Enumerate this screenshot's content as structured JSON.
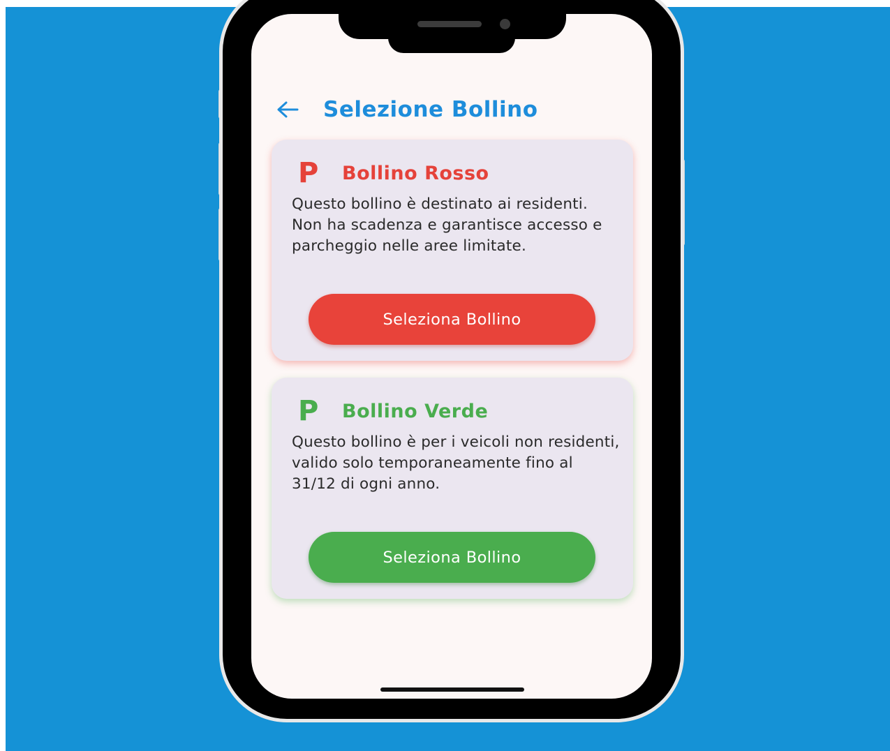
{
  "header": {
    "title": "Selezione Bollino",
    "back_icon": "arrow-left-icon"
  },
  "cards": [
    {
      "icon_letter": "P",
      "title": "Bollino Rosso",
      "description": "Questo bollino è destinato ai residenti. Non ha scadenza e garantisce accesso e parcheggio nelle aree limitate.",
      "button_label": "Seleziona Bollino",
      "color": "#e5423a"
    },
    {
      "icon_letter": "P",
      "title": "Bollino Verde",
      "description": "Questo bollino è per i veicoli non residenti, valido solo temporaneamente fino al 31/12 di ogni anno.",
      "button_label": "Seleziona Bollino",
      "color": "#4aad4e"
    }
  ],
  "theme": {
    "background": "#1592d6",
    "accent": "#1e8ddb",
    "card_background": "#ebe6f0",
    "screen_background": "#fdf7f6"
  }
}
